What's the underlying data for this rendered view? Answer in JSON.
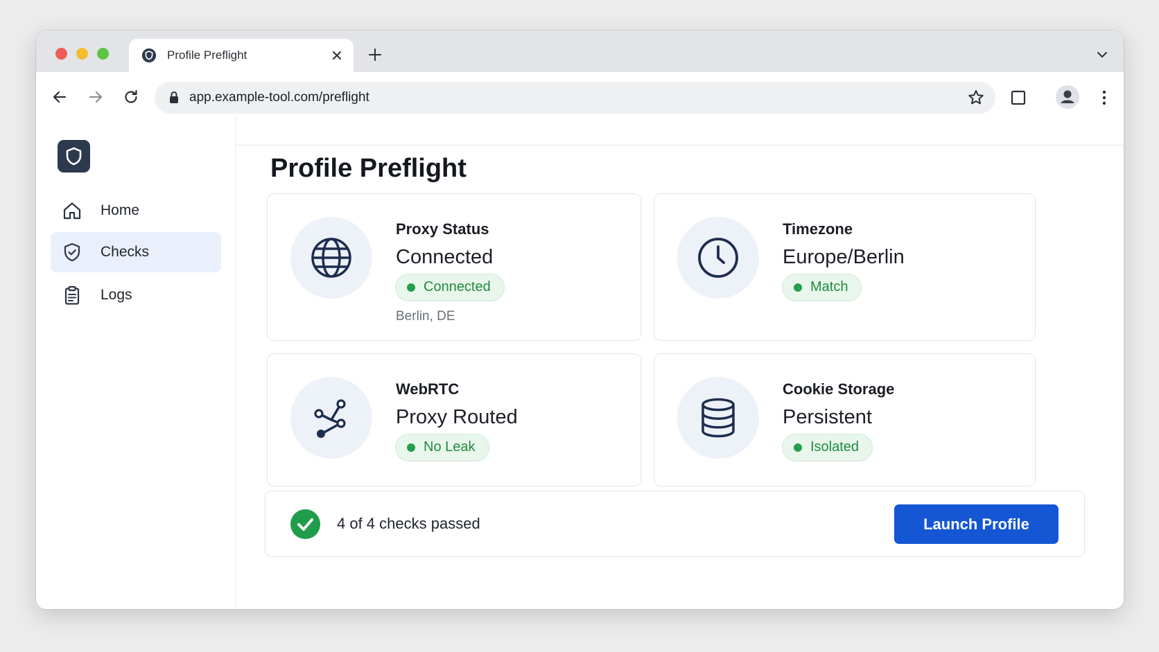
{
  "browser": {
    "tab_title": "Profile Preflight",
    "url": "app.example-tool.com/preflight"
  },
  "sidebar": {
    "items": [
      {
        "label": "Home",
        "icon": "home-icon",
        "active": false
      },
      {
        "label": "Checks",
        "icon": "shield-check-icon",
        "active": true
      },
      {
        "label": "Logs",
        "icon": "clipboard-icon",
        "active": false
      }
    ]
  },
  "main": {
    "title": "Profile Preflight",
    "cards": [
      {
        "label": "Proxy Status",
        "value": "Connected",
        "badge": "Connected",
        "sub": "Berlin, DE",
        "icon": "globe-icon"
      },
      {
        "label": "Timezone",
        "value": "Europe/Berlin",
        "badge": "Match",
        "icon": "clock-icon"
      },
      {
        "label": "WebRTC",
        "value": "Proxy Routed",
        "badge": "No Leak",
        "icon": "share-nodes-icon"
      },
      {
        "label": "Cookie Storage",
        "value": "Persistent",
        "badge": "Isolated",
        "icon": "database-icon"
      }
    ],
    "summary": {
      "text": "4 of 4 checks passed",
      "button": "Launch Profile"
    }
  },
  "colors": {
    "accent": "#1456d4",
    "success": "#1f9d4a",
    "icon": "#1d2d4f",
    "active_nav": "#eaf0fb"
  }
}
